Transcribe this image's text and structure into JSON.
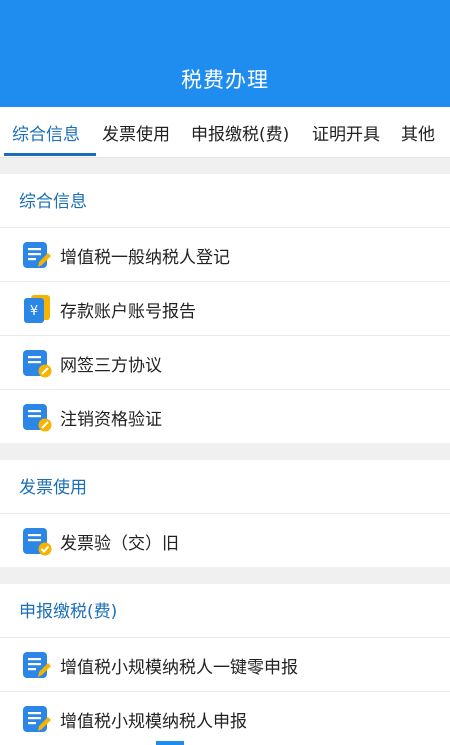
{
  "header": {
    "title": "税费办理"
  },
  "tabs": [
    {
      "label": "综合信息"
    },
    {
      "label": "发票使用"
    },
    {
      "label": "申报缴税(费)"
    },
    {
      "label": "证明开具"
    },
    {
      "label": "其他"
    }
  ],
  "sections": [
    {
      "title": "综合信息",
      "items": [
        {
          "label": "增值税一般纳税人登记",
          "icon": "form-edit-icon"
        },
        {
          "label": "存款账户账号报告",
          "icon": "yuan-card-icon"
        },
        {
          "label": "网签三方协议",
          "icon": "form-link-icon"
        },
        {
          "label": "注销资格验证",
          "icon": "form-link-icon"
        }
      ]
    },
    {
      "title": "发票使用",
      "items": [
        {
          "label": "发票验（交）旧",
          "icon": "form-check-icon"
        }
      ]
    },
    {
      "title": "申报缴税(费)",
      "items": [
        {
          "label": "增值税小规模纳税人一键零申报",
          "icon": "form-edit-icon"
        },
        {
          "label": "增值税小规模纳税人申报",
          "icon": "form-edit-icon"
        }
      ]
    }
  ],
  "colors": {
    "header_bg": "#1f8cf0",
    "accent": "#1a6fb8",
    "icon_blue": "#2c86e6",
    "icon_yellow": "#f6b400"
  }
}
